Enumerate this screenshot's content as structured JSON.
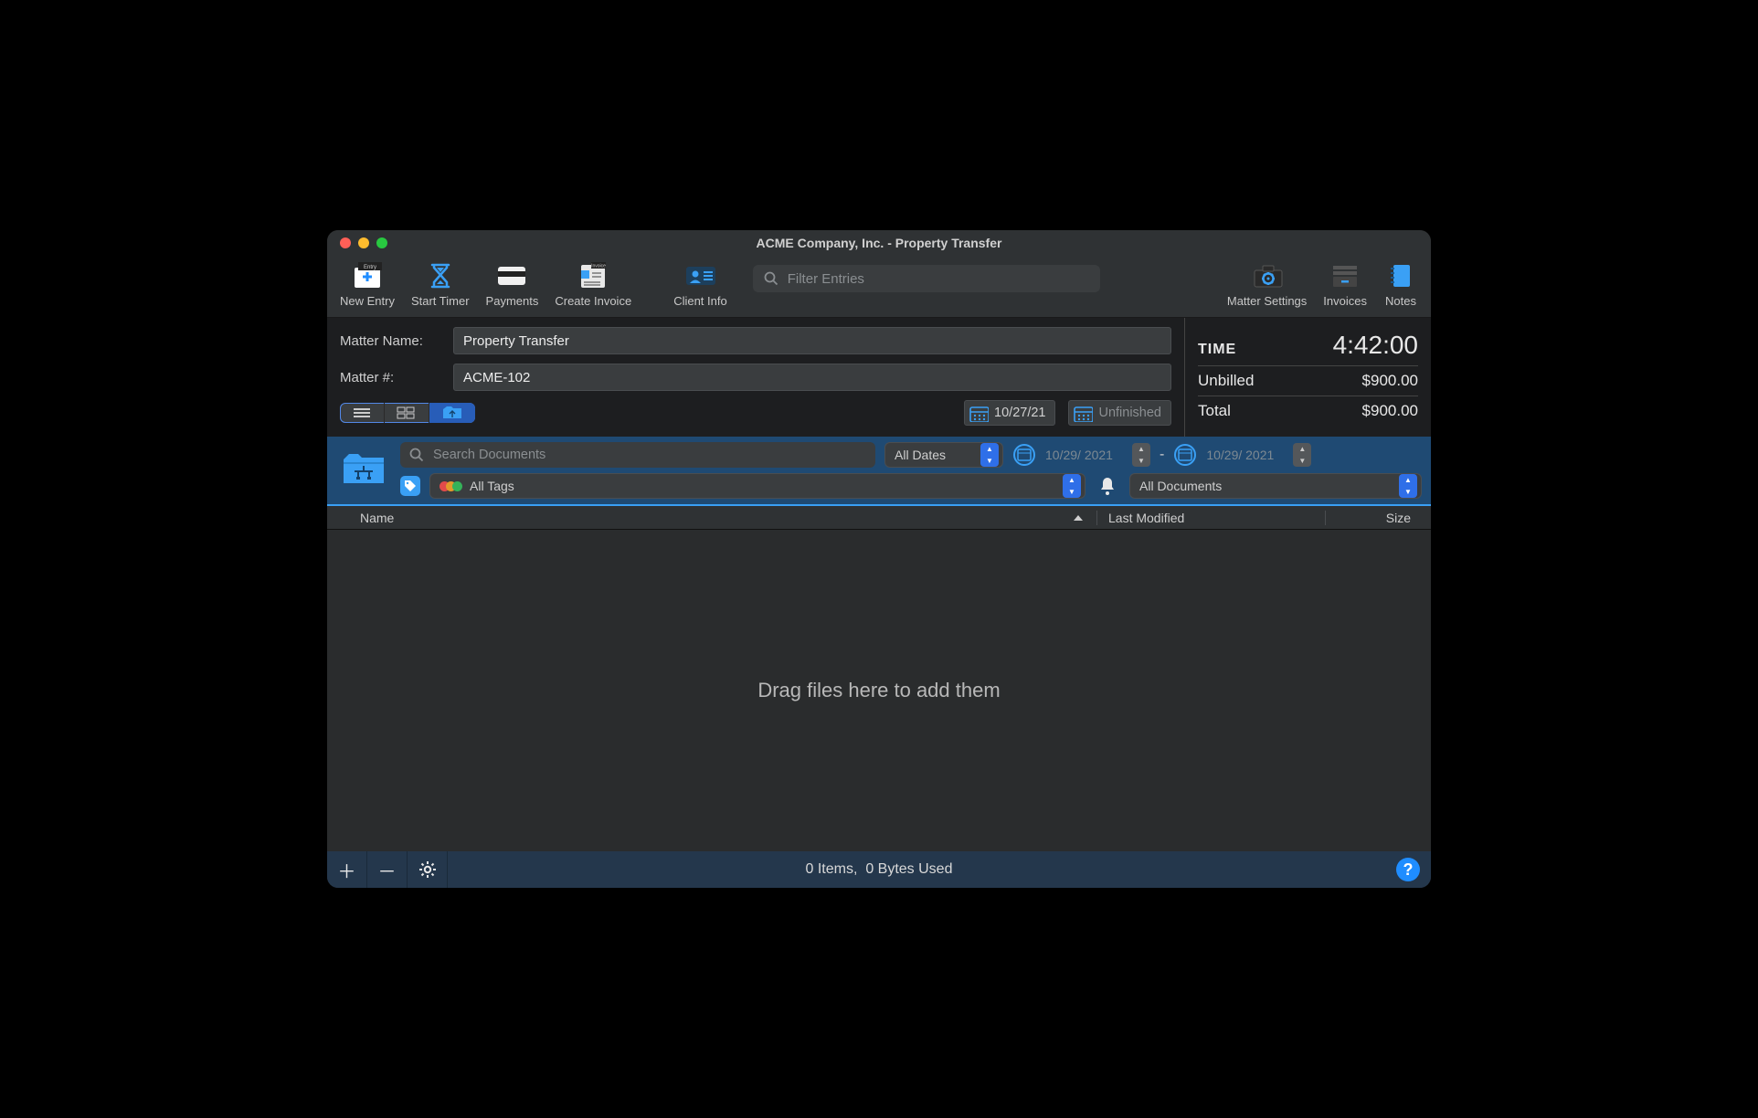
{
  "window_title": "ACME Company, Inc. - Property Transfer",
  "toolbar": {
    "new_entry": "New Entry",
    "start_timer": "Start Timer",
    "payments": "Payments",
    "create_invoice": "Create Invoice",
    "client_info": "Client Info",
    "filter_placeholder": "Filter Entries",
    "matter_settings": "Matter Settings",
    "invoices": "Invoices",
    "notes": "Notes"
  },
  "matter": {
    "name_label": "Matter Name:",
    "name_value": "Property Transfer",
    "number_label": "Matter #:",
    "number_value": "ACME-102",
    "date": "10/27/21",
    "unfinished": "Unfinished"
  },
  "summary": {
    "time_label": "TIME",
    "time_value": "4:42:00",
    "unbilled_label": "Unbilled",
    "unbilled_value": "$900.00",
    "total_label": "Total",
    "total_value": "$900.00"
  },
  "filters": {
    "search_placeholder": "Search Documents",
    "date_mode": "All Dates",
    "date_from": "10/29/ 2021",
    "date_to": "10/29/ 2021",
    "tags": "All Tags",
    "doc_type": "All Documents"
  },
  "columns": {
    "name": "Name",
    "modified": "Last Modified",
    "size": "Size"
  },
  "list": {
    "empty": "Drag files here to add them"
  },
  "statusbar": {
    "items": "0 Items,",
    "bytes": "0 Bytes Used"
  }
}
